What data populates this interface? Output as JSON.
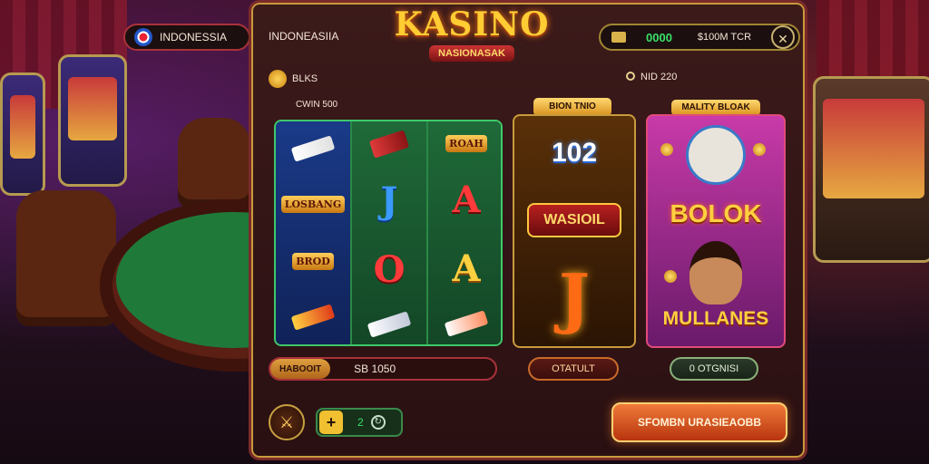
{
  "header": {
    "lang_primary": "INDONESSIA",
    "lang_secondary": "INDONEASIIA",
    "logo_title": "KASINO",
    "logo_subtitle": "NASIONASAK",
    "credit_value": "0000",
    "bet_label": "$100M TCR",
    "settings_icon": "settings-icon"
  },
  "subheader": {
    "coin_label": "BLKS",
    "gem_label": "NID 220"
  },
  "slots": {
    "tag": "CWIN 500",
    "reels": [
      [
        "",
        "LOSBANG",
        "BROD",
        ""
      ],
      [
        "",
        "J",
        "O",
        ""
      ],
      [
        "ROAH",
        "A",
        "A",
        ""
      ]
    ]
  },
  "bonus": {
    "tag": "BION TNIO",
    "number": "102",
    "crest": "WASIOIL",
    "letter": "J",
    "button": "OTATULT"
  },
  "promo": {
    "tag": "MALITY BLOAK",
    "logo": "BOLOK",
    "title": "MULLANES",
    "button": "0 OTGNISI"
  },
  "footer": {
    "balance_label": "HABOOIT",
    "balance_value": "SB 1050",
    "round_icon": "swords-icon",
    "counter": "2",
    "cta": "SFOMBN URASIEAOBB"
  },
  "colors": {
    "accent_gold": "#ffcc33",
    "accent_green": "#3be06a",
    "panel_border": "#7a2a2a",
    "cta": "#f07a3a"
  }
}
